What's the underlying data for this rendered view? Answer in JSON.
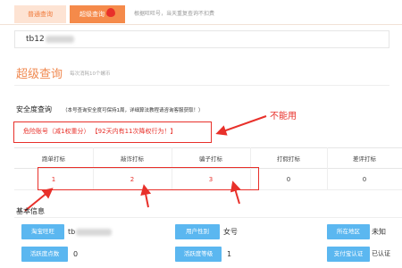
{
  "tabs": {
    "normal": "普通查询",
    "super": "超级查询",
    "hint": "根据旺旺号，当天重复查询不扣费"
  },
  "search": {
    "value": "tb12"
  },
  "section": {
    "title": "超级查询",
    "subtitle": "每次消耗10个螺币"
  },
  "security": {
    "title": "安全度查询",
    "note": "（本号查询安全度可保持1周，详细算法教程请咨询客服获取！）",
    "danger": "危险账号（减1权重分）  【92天内有11次降权行为！】"
  },
  "annotation": {
    "label": "不能用"
  },
  "table": {
    "headers": [
      "跑单打标",
      "敲诈打标",
      "骗子打标",
      "打假打标",
      "差评打标"
    ],
    "values": [
      "1",
      "2",
      "3",
      "0",
      "0"
    ]
  },
  "basic": {
    "title": "基本信息",
    "rows": [
      [
        {
          "label": "淘宝旺旺",
          "value": "tb"
        },
        {
          "label": "用户性别",
          "value": "女号"
        },
        {
          "label": "所在地区",
          "value": "未知"
        }
      ],
      [
        {
          "label": "活跃度点数",
          "value": "0"
        },
        {
          "label": "活跃度等级",
          "value": "1"
        },
        {
          "label": "支付宝认证",
          "value": "已认证"
        }
      ]
    ]
  },
  "colors": {
    "accent": "#f58a4a",
    "danger": "#e8302a",
    "label_bg": "#5bb7f0"
  }
}
